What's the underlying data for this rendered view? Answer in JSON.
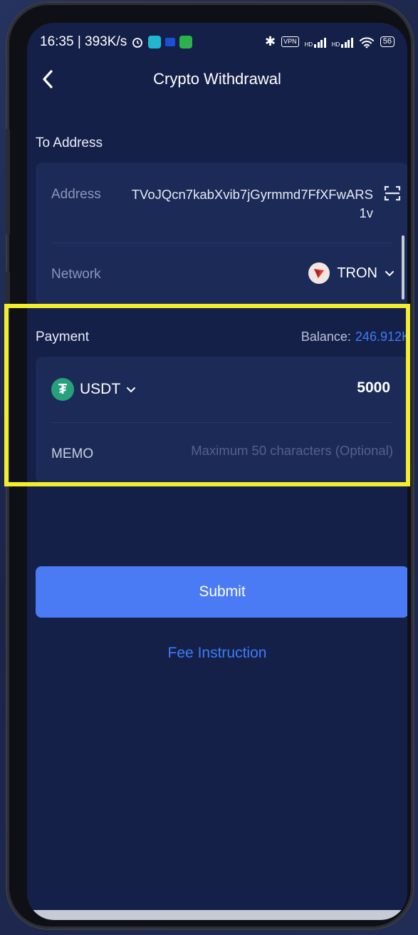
{
  "status_bar": {
    "time_speed": "16:35 | 393K/s",
    "vpn": "VPN",
    "signal_label": "HD",
    "battery": "56"
  },
  "header": {
    "title": "Crypto Withdrawal",
    "back_icon": "chevron-left-icon"
  },
  "to_address": {
    "section_label": "To Address",
    "address_label": "Address",
    "address_value": "TVoJQcn7kabXvib7jGyrmmd7FfXFwARS1v",
    "scan_icon": "scan-icon",
    "network_label": "Network",
    "network_value": "TRON"
  },
  "payment": {
    "section_label": "Payment",
    "balance_label": "Balance:",
    "balance_value": "246.912K",
    "coin": "USDT",
    "amount": "5000",
    "memo_label": "MEMO",
    "memo_placeholder": "Maximum 50 characters (Optional)"
  },
  "actions": {
    "submit": "Submit",
    "fee_instruction": "Fee Instruction"
  },
  "colors": {
    "accent": "#4a7bf5",
    "link": "#3d7bf7",
    "highlight": "#f2ee2d",
    "background": "#152049",
    "card": "#1c2a58"
  }
}
